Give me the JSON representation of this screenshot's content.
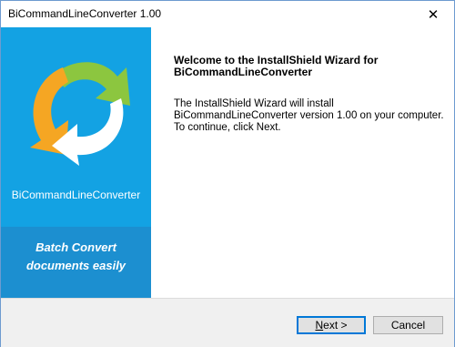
{
  "window": {
    "title": "BiCommandLineConverter 1.00",
    "close_glyph": "✕"
  },
  "sidebar": {
    "product_name": "BiCommandLineConverter",
    "tagline_line1": "Batch Convert",
    "tagline_line2": "documents easily",
    "logo": "circular-arrows-icon",
    "colors": {
      "panel": "#13a2e3",
      "band": "#1c8fd0",
      "arrow_yellow": "#f5a623",
      "arrow_green": "#8cc63f",
      "arrow_white": "#ffffff"
    }
  },
  "content": {
    "heading_line1": "Welcome to the InstallShield Wizard for",
    "heading_line2": "BiCommandLineConverter",
    "body_line1": "The InstallShield Wizard will install",
    "body_line2": "BiCommandLineConverter version 1.00 on your computer.",
    "body_line3": "To continue, click Next."
  },
  "buttons": {
    "next_mnemonic": "N",
    "next_rest": "ext >",
    "cancel_label": "Cancel"
  }
}
